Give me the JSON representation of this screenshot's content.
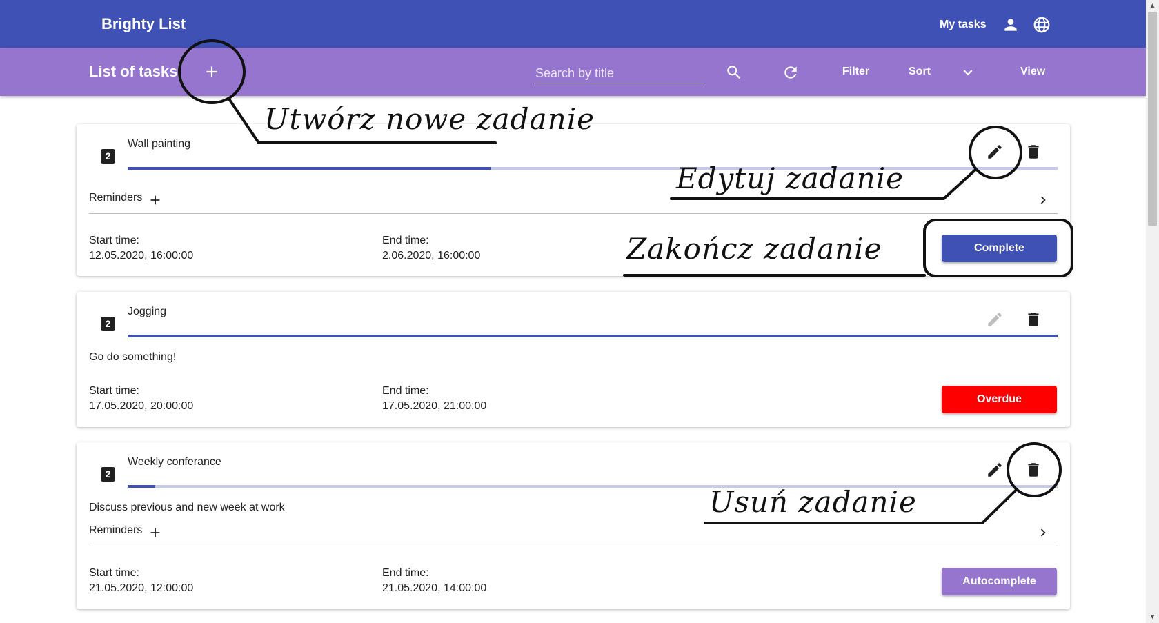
{
  "app": {
    "title": "Brighty List"
  },
  "header": {
    "my_tasks": "My tasks",
    "icons": [
      "account-icon",
      "language-globe-icon"
    ]
  },
  "toolbar": {
    "title": "List of tasks",
    "add_icon": "plus-icon",
    "search_placeholder": "Search by title",
    "search_value": "",
    "filter_label": "Filter",
    "sort_label": "Sort",
    "view_label": "View"
  },
  "colors": {
    "primary": "#3f51b5",
    "secondary": "#9575cd",
    "overdue": "#ff0000",
    "autocomplete": "#9575cd",
    "progress_track": "#c5cae9"
  },
  "labels": {
    "reminders": "Reminders",
    "start_time": "Start time:",
    "end_time": "End time:"
  },
  "tasks": [
    {
      "priority": "2",
      "title": "Wall painting",
      "progress": 0.39,
      "description": "",
      "has_reminders": true,
      "start": "12.05.2020, 16:00:00",
      "end": "2.06.2020, 16:00:00",
      "status_button": "Complete",
      "status_color": "#3f51b5",
      "edit_enabled": true
    },
    {
      "priority": "2",
      "title": "Jogging",
      "progress": 1.0,
      "description": "Go do something!",
      "has_reminders": false,
      "start": "17.05.2020, 20:00:00",
      "end": "17.05.2020, 21:00:00",
      "status_button": "Overdue",
      "status_color": "#ff0000",
      "edit_enabled": false
    },
    {
      "priority": "2",
      "title": "Weekly conferance",
      "progress": 0.03,
      "description": "Discuss previous and new week at work",
      "has_reminders": true,
      "start": "21.05.2020, 12:00:00",
      "end": "21.05.2020, 14:00:00",
      "status_button": "Autocomplete",
      "status_color": "#9575cd",
      "edit_enabled": true
    }
  ],
  "annotations": {
    "create_task": "Utwórz nowe zadanie",
    "edit_task": "Edytuj zadanie",
    "complete_task": "Zakończ zadanie",
    "delete_task": "Usuń zadanie"
  }
}
